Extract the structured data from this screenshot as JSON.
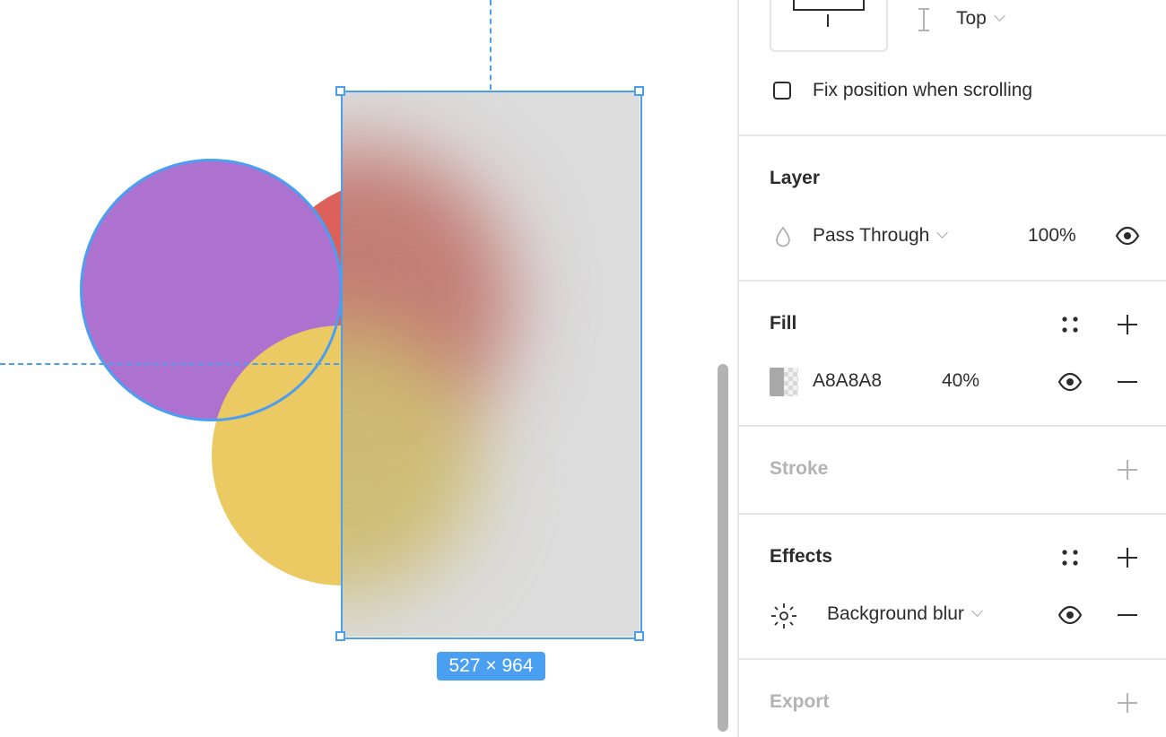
{
  "canvas": {
    "selection_size_label": "527 × 964",
    "selected_layer_colors": {
      "selection": "#4a9ff0",
      "circle_purple": "#ad72d0",
      "circle_red": "#dc615b",
      "circle_yellow": "#ebc963",
      "glass_fill": "#dcdcdc"
    }
  },
  "panel": {
    "constraints": {
      "vertical_value": "Top"
    },
    "fix_position": {
      "label": "Fix position when scrolling",
      "checked": false
    },
    "layer": {
      "title": "Layer",
      "blend_mode": "Pass Through",
      "opacity": "100%"
    },
    "fill": {
      "title": "Fill",
      "hex": "A8A8A8",
      "opacity": "40%",
      "color": "#a8a8a8"
    },
    "stroke": {
      "title": "Stroke"
    },
    "effects": {
      "title": "Effects",
      "effect_type": "Background blur"
    },
    "export": {
      "title": "Export"
    }
  }
}
